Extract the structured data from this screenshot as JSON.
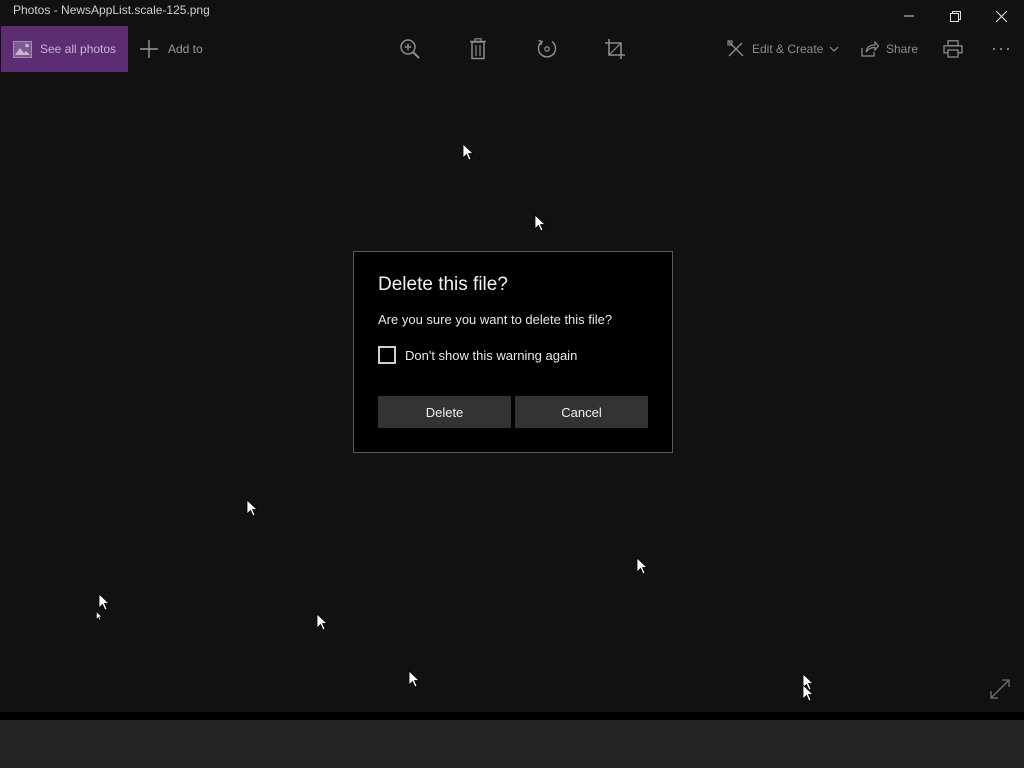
{
  "window": {
    "title": "Photos - NewsAppList.scale-125.png"
  },
  "toolbar": {
    "see_all_label": "See all photos",
    "add_to_label": "Add to",
    "edit_create_label": "Edit & Create",
    "share_label": "Share",
    "icons": [
      "zoom-in-icon",
      "delete-icon",
      "rotate-icon",
      "crop-icon",
      "print-icon",
      "more-icon"
    ]
  },
  "dialog": {
    "title": "Delete this file?",
    "message": "Are you sure you want to delete this file?",
    "checkbox_label": "Don't show this warning again",
    "checkbox_checked": false,
    "delete_label": "Delete",
    "cancel_label": "Cancel"
  },
  "colors": {
    "accent": "#5c2d73",
    "background": "#111112",
    "dialog_bg": "#000000",
    "button_bg": "#333333"
  }
}
